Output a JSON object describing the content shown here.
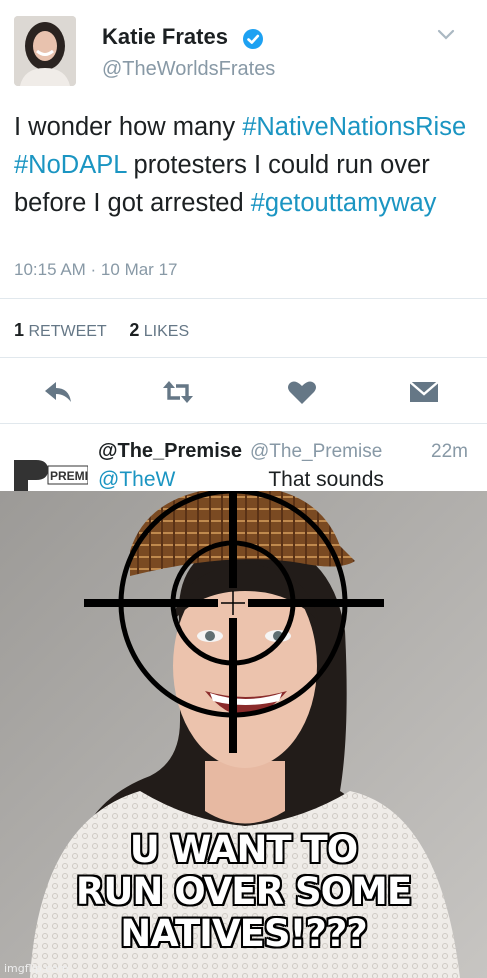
{
  "tweet": {
    "author_name": "Katie Frates",
    "handle": "@TheWorldsFrates",
    "text_parts": [
      {
        "text": "I wonder how many ",
        "hashtag": false
      },
      {
        "text": "#NativeNationsRise",
        "hashtag": true
      },
      {
        "text": " ",
        "hashtag": false
      },
      {
        "text": "#NoDAPL",
        "hashtag": true
      },
      {
        "text": " protesters I could run over before I got arrested ",
        "hashtag": false
      },
      {
        "text": "#getouttamyway",
        "hashtag": true
      }
    ],
    "timestamp": "10:15 AM · 10 Mar 17",
    "retweet_count": "1",
    "retweet_label": "RETWEET",
    "like_count": "2",
    "like_label": "LIKES",
    "actions": [
      "reply-icon",
      "retweet-icon",
      "like-icon",
      "message-icon"
    ]
  },
  "reply": {
    "name": "@The_Premise",
    "handle": "@The_Premise",
    "time": "22m",
    "logo_text": "PREMISE",
    "text_start": "@TheW",
    "text_end": "That sounds"
  },
  "meme": {
    "caption_lines": [
      "U WANT TO",
      "RUN OVER SOME",
      "NATIVES!???"
    ],
    "watermark": "imgflip.com"
  },
  "colors": {
    "hashtag": "#1b95c2",
    "verified": "#1da1f2",
    "icon": "#657786",
    "muted": "#8899a6"
  }
}
